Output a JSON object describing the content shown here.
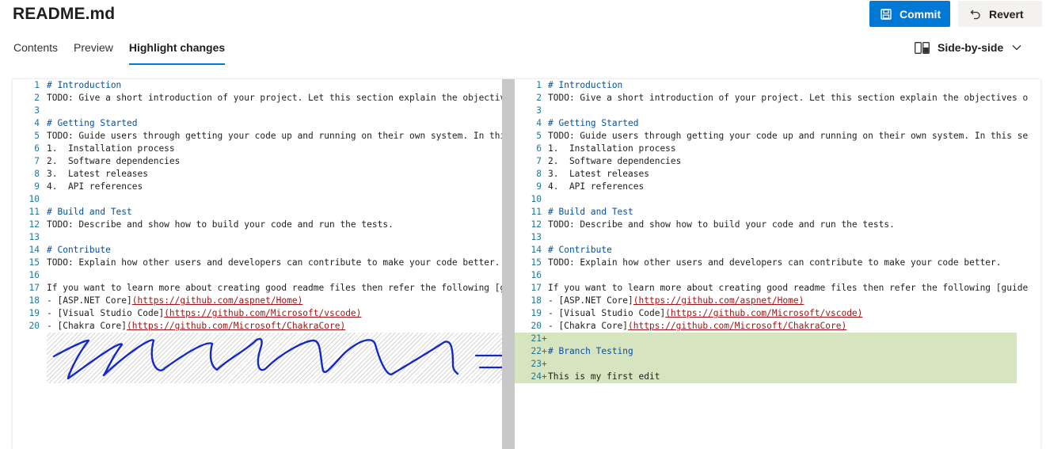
{
  "header": {
    "title": "README.md",
    "commit_label": "Commit",
    "revert_label": "Revert"
  },
  "tabs": [
    {
      "label": "Contents",
      "active": false
    },
    {
      "label": "Preview",
      "active": false
    },
    {
      "label": "Highlight changes",
      "active": true
    }
  ],
  "view_mode": {
    "label": "Side-by-side",
    "icon": "side-by-side-icon"
  },
  "icons": {
    "commit": "save-icon",
    "revert": "undo-icon",
    "dropdown": "chevron-down-icon"
  },
  "colors": {
    "accent": "#0078d4",
    "added_bg": "#d6e4c0",
    "heading": "#0451a5",
    "link": "#a31515",
    "line_number": "#237893"
  },
  "diff": {
    "left": [
      {
        "n": "1",
        "text": "# Introduction",
        "kind": "heading"
      },
      {
        "n": "2",
        "text": "TODO: Give a short introduction of your project. Let this section explain the objectives o",
        "kind": "text"
      },
      {
        "n": "3",
        "text": "",
        "kind": "text"
      },
      {
        "n": "4",
        "text": "# Getting Started",
        "kind": "heading"
      },
      {
        "n": "5",
        "text": "TODO: Guide users through getting your code up and running on their own system. In this se",
        "kind": "text"
      },
      {
        "n": "6",
        "text": "1.  Installation process",
        "kind": "text"
      },
      {
        "n": "7",
        "text": "2.  Software dependencies",
        "kind": "text"
      },
      {
        "n": "8",
        "text": "3.  Latest releases",
        "kind": "text"
      },
      {
        "n": "9",
        "text": "4.  API references",
        "kind": "text"
      },
      {
        "n": "10",
        "text": "",
        "kind": "text"
      },
      {
        "n": "11",
        "text": "# Build and Test",
        "kind": "heading"
      },
      {
        "n": "12",
        "text": "TODO: Describe and show how to build your code and run the tests.",
        "kind": "text"
      },
      {
        "n": "13",
        "text": "",
        "kind": "text"
      },
      {
        "n": "14",
        "text": "# Contribute",
        "kind": "heading"
      },
      {
        "n": "15",
        "text": "TODO: Explain how other users and developers can contribute to make your code better.",
        "kind": "text"
      },
      {
        "n": "16",
        "text": "",
        "kind": "text"
      },
      {
        "n": "17",
        "text": "If you want to learn more about creating good readme files then refer the following [guide",
        "kind": "text"
      },
      {
        "n": "18",
        "pre": "- [ASP.NET Core]",
        "url": "(https://github.com/aspnet/Home)",
        "kind": "link"
      },
      {
        "n": "19",
        "pre": "- [Visual Studio Code]",
        "url": "(https://github.com/Microsoft/vscode)",
        "kind": "link"
      },
      {
        "n": "20",
        "pre": "- [Chakra Core]",
        "url": "(https://github.com/Microsoft/ChakraCore)",
        "kind": "link"
      }
    ],
    "right": [
      {
        "n": "1",
        "text": "# Introduction",
        "kind": "heading"
      },
      {
        "n": "2",
        "text": "TODO: Give a short introduction of your project. Let this section explain the objectives o",
        "kind": "text"
      },
      {
        "n": "3",
        "text": "",
        "kind": "text"
      },
      {
        "n": "4",
        "text": "# Getting Started",
        "kind": "heading"
      },
      {
        "n": "5",
        "text": "TODO: Guide users through getting your code up and running on their own system. In this se",
        "kind": "text"
      },
      {
        "n": "6",
        "text": "1.  Installation process",
        "kind": "text"
      },
      {
        "n": "7",
        "text": "2.  Software dependencies",
        "kind": "text"
      },
      {
        "n": "8",
        "text": "3.  Latest releases",
        "kind": "text"
      },
      {
        "n": "9",
        "text": "4.  API references",
        "kind": "text"
      },
      {
        "n": "10",
        "text": "",
        "kind": "text"
      },
      {
        "n": "11",
        "text": "# Build and Test",
        "kind": "heading"
      },
      {
        "n": "12",
        "text": "TODO: Describe and show how to build your code and run the tests.",
        "kind": "text"
      },
      {
        "n": "13",
        "text": "",
        "kind": "text"
      },
      {
        "n": "14",
        "text": "# Contribute",
        "kind": "heading"
      },
      {
        "n": "15",
        "text": "TODO: Explain how other users and developers can contribute to make your code better.",
        "kind": "text"
      },
      {
        "n": "16",
        "text": "",
        "kind": "text"
      },
      {
        "n": "17",
        "text": "If you want to learn more about creating good readme files then refer the following [guide",
        "kind": "text"
      },
      {
        "n": "18",
        "pre": "- [ASP.NET Core]",
        "url": "(https://github.com/aspnet/Home)",
        "kind": "link"
      },
      {
        "n": "19",
        "pre": "- [Visual Studio Code]",
        "url": "(https://github.com/Microsoft/vscode)",
        "kind": "link"
      },
      {
        "n": "20",
        "pre": "- [Chakra Core]",
        "url": "(https://github.com/Microsoft/ChakraCore)",
        "kind": "link"
      },
      {
        "n": "21",
        "text": "",
        "kind": "added"
      },
      {
        "n": "22",
        "text": "# Branch Testing",
        "kind": "added-heading"
      },
      {
        "n": "23",
        "text": "",
        "kind": "added"
      },
      {
        "n": "24",
        "text": "This is my first edit",
        "kind": "added"
      }
    ]
  }
}
